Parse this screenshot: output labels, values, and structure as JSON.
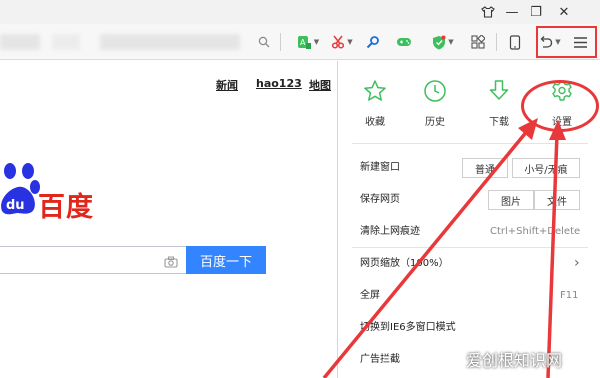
{
  "titlebar": {
    "icons": [
      "shirt-icon",
      "minimize-icon",
      "restore-icon",
      "close-icon"
    ],
    "minimize": "—",
    "restore": "❐",
    "close": "✕"
  },
  "toolbar": {
    "icons": [
      "search-icon",
      "app-icon",
      "scissors-icon",
      "key-icon",
      "gamepad-icon",
      "shield-icon",
      "grid-icon",
      "tablet-icon",
      "undo-icon",
      "menu-icon"
    ]
  },
  "page": {
    "links": [
      "新闻",
      "hao123",
      "地图"
    ],
    "logo_text": "百度",
    "search_button": "百度一下"
  },
  "menu": {
    "top_items": [
      {
        "label": "收藏",
        "icon": "star-icon"
      },
      {
        "label": "历史",
        "icon": "clock-icon"
      },
      {
        "label": "下载",
        "icon": "download-icon"
      },
      {
        "label": "设置",
        "icon": "gear-icon"
      }
    ],
    "new_window": {
      "label": "新建窗口",
      "opt1": "普通",
      "opt2": "小号/无痕"
    },
    "save_page": {
      "label": "保存网页",
      "opt1": "图片",
      "opt2": "文件"
    },
    "clear_history": {
      "label": "清除上网痕迹",
      "shortcut": "Ctrl+Shift+Delete"
    },
    "zoom": {
      "label": "网页缩放（100%）",
      "arrow": "›"
    },
    "fullscreen": {
      "label": "全屏",
      "shortcut": "F11"
    },
    "ie6_mode": {
      "label": "切换到IE6多窗口模式"
    },
    "ad_block": {
      "label": "广告拦截"
    }
  },
  "watermark": "爱创根知识网",
  "colors": {
    "accent_green": "#3cbf5c",
    "annotation_red": "#e8383a",
    "baidu_blue": "#3385ff",
    "baidu_red": "#e1261c"
  }
}
